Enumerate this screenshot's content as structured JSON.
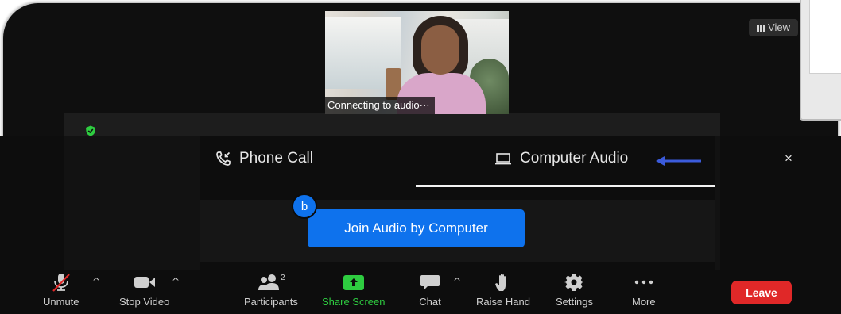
{
  "video": {
    "caption": "Connecting to audio···"
  },
  "view_button": {
    "label": "View",
    "icon": "grid-icon"
  },
  "dialog": {
    "tabs": [
      {
        "label": "Phone Call",
        "icon": "phone-icon",
        "active": false
      },
      {
        "label": "Computer Audio",
        "icon": "laptop-icon",
        "active": true
      }
    ],
    "close_label": "×",
    "join_label": "Join Audio by Computer",
    "badge": "b",
    "arrow_color": "#3b5bdb"
  },
  "toolbar": {
    "unmute": "Unmute",
    "stop_video": "Stop Video",
    "participants": "Participants",
    "participants_count": "2",
    "share_screen": "Share Screen",
    "chat": "Chat",
    "raise_hand": "Raise Hand",
    "settings": "Settings",
    "more": "More",
    "leave": "Leave"
  },
  "colors": {
    "accent": "#0e72ed",
    "leave": "#e02828",
    "share": "#2ecc40",
    "security": "#2ecc40"
  }
}
